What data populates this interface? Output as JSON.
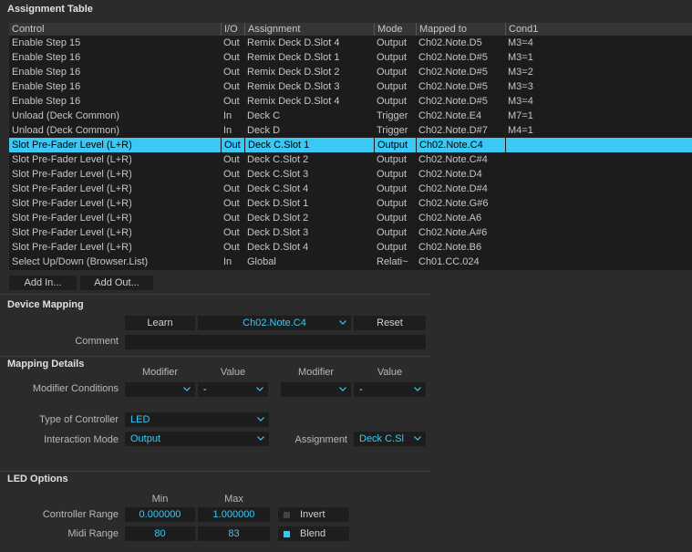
{
  "assignment_table": {
    "title": "Assignment Table",
    "columns": [
      "Control",
      "I/O",
      "Assignment",
      "Mode",
      "Mapped to",
      "Cond1"
    ],
    "rows": [
      {
        "control": "Enable Step 15",
        "io": "Out",
        "assignment": "Remix Deck D.Slot 4",
        "mode": "Output",
        "mapped": "Ch02.Note.D5",
        "cond": "M3=4",
        "selected": false
      },
      {
        "control": "Enable Step 16",
        "io": "Out",
        "assignment": "Remix Deck D.Slot 1",
        "mode": "Output",
        "mapped": "Ch02.Note.D#5",
        "cond": "M3=1",
        "selected": false
      },
      {
        "control": "Enable Step 16",
        "io": "Out",
        "assignment": "Remix Deck D.Slot 2",
        "mode": "Output",
        "mapped": "Ch02.Note.D#5",
        "cond": "M3=2",
        "selected": false
      },
      {
        "control": "Enable Step 16",
        "io": "Out",
        "assignment": "Remix Deck D.Slot 3",
        "mode": "Output",
        "mapped": "Ch02.Note.D#5",
        "cond": "M3=3",
        "selected": false
      },
      {
        "control": "Enable Step 16",
        "io": "Out",
        "assignment": "Remix Deck D.Slot 4",
        "mode": "Output",
        "mapped": "Ch02.Note.D#5",
        "cond": "M3=4",
        "selected": false
      },
      {
        "control": "Unload (Deck Common)",
        "io": "In",
        "assignment": "Deck C",
        "mode": "Trigger",
        "mapped": "Ch02.Note.E4",
        "cond": "M7=1",
        "selected": false
      },
      {
        "control": "Unload (Deck Common)",
        "io": "In",
        "assignment": "Deck D",
        "mode": "Trigger",
        "mapped": "Ch02.Note.D#7",
        "cond": "M4=1",
        "selected": false
      },
      {
        "control": "Slot Pre-Fader Level (L+R)",
        "io": "Out",
        "assignment": "Deck C.Slot 1",
        "mode": "Output",
        "mapped": "Ch02.Note.C4",
        "cond": "",
        "selected": true
      },
      {
        "control": "Slot Pre-Fader Level (L+R)",
        "io": "Out",
        "assignment": "Deck C.Slot 2",
        "mode": "Output",
        "mapped": "Ch02.Note.C#4",
        "cond": "",
        "selected": false
      },
      {
        "control": "Slot Pre-Fader Level (L+R)",
        "io": "Out",
        "assignment": "Deck C.Slot 3",
        "mode": "Output",
        "mapped": "Ch02.Note.D4",
        "cond": "",
        "selected": false
      },
      {
        "control": "Slot Pre-Fader Level (L+R)",
        "io": "Out",
        "assignment": "Deck C.Slot 4",
        "mode": "Output",
        "mapped": "Ch02.Note.D#4",
        "cond": "",
        "selected": false
      },
      {
        "control": "Slot Pre-Fader Level (L+R)",
        "io": "Out",
        "assignment": "Deck D.Slot 1",
        "mode": "Output",
        "mapped": "Ch02.Note.G#6",
        "cond": "",
        "selected": false
      },
      {
        "control": "Slot Pre-Fader Level (L+R)",
        "io": "Out",
        "assignment": "Deck D.Slot 2",
        "mode": "Output",
        "mapped": "Ch02.Note.A6",
        "cond": "",
        "selected": false
      },
      {
        "control": "Slot Pre-Fader Level (L+R)",
        "io": "Out",
        "assignment": "Deck D.Slot 3",
        "mode": "Output",
        "mapped": "Ch02.Note.A#6",
        "cond": "",
        "selected": false
      },
      {
        "control": "Slot Pre-Fader Level (L+R)",
        "io": "Out",
        "assignment": "Deck D.Slot 4",
        "mode": "Output",
        "mapped": "Ch02.Note.B6",
        "cond": "",
        "selected": false
      },
      {
        "control": "Select Up/Down (Browser.List)",
        "io": "In",
        "assignment": "Global",
        "mode": "Relati~",
        "mapped": "Ch01.CC.024",
        "cond": "",
        "selected": false
      }
    ],
    "add_in_label": "Add In...",
    "add_out_label": "Add Out..."
  },
  "device_mapping": {
    "title": "Device Mapping",
    "learn_label": "Learn",
    "mapped_value": "Ch02.Note.C4",
    "reset_label": "Reset",
    "comment_label": "Comment",
    "comment_value": ""
  },
  "mapping_details": {
    "title": "Mapping Details",
    "modifier_header": "Modifier",
    "value_header": "Value",
    "modifier_conditions_label": "Modifier Conditions",
    "cond1_modifier": "",
    "cond1_value": "-",
    "cond2_modifier": "",
    "cond2_value": "-",
    "type_of_controller_label": "Type of Controller",
    "type_of_controller_value": "LED",
    "interaction_mode_label": "Interaction Mode",
    "interaction_mode_value": "Output",
    "assignment_label": "Assignment",
    "assignment_value": "Deck C.Sl"
  },
  "led_options": {
    "title": "LED Options",
    "min_header": "Min",
    "max_header": "Max",
    "controller_range_label": "Controller Range",
    "controller_min": "0.000000",
    "controller_max": "1.000000",
    "midi_range_label": "Midi Range",
    "midi_min": "80",
    "midi_max": "83",
    "invert_label": "Invert",
    "invert_checked": false,
    "blend_label": "Blend",
    "blend_checked": true
  },
  "colors": {
    "accent": "#3cc8f5",
    "background": "#2b2b2b",
    "field": "#1d1d1d"
  }
}
